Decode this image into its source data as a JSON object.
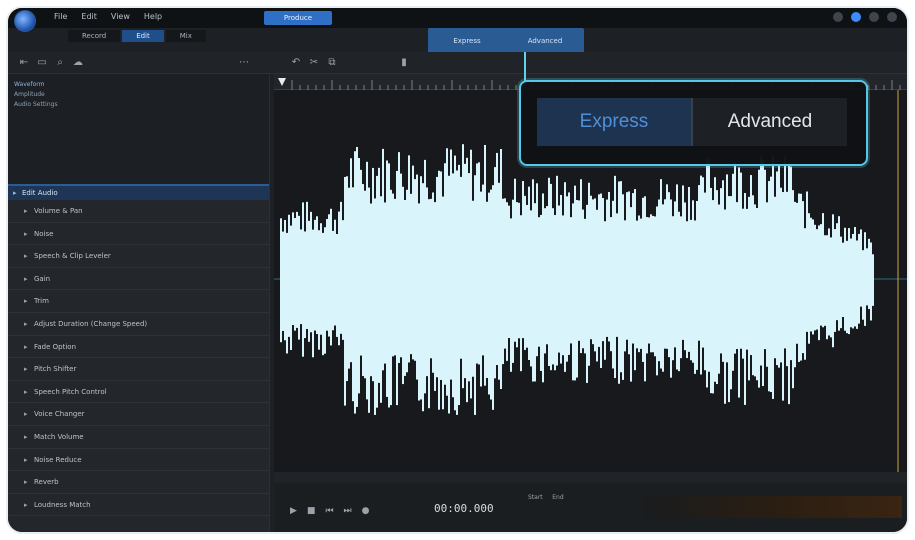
{
  "titlebar": {
    "menu": [
      "File",
      "Edit",
      "View",
      "Help"
    ],
    "tabs": [
      "Record",
      "Edit",
      "Mix"
    ],
    "produce_label": "Produce"
  },
  "mode_toggle": {
    "express": "Express",
    "advanced": "Advanced"
  },
  "left_panel": {
    "status_items": [
      "Waveform",
      "Amplitude",
      "Audio Settings"
    ],
    "section": "Edit Audio",
    "effects": [
      "Volume & Pan",
      "Noise",
      "Speech & Clip Leveler",
      "Gain",
      "Trim",
      "Adjust Duration (Change Speed)",
      "Fade Option",
      "Pitch Shifter",
      "Speech Pitch Control",
      "Voice Changer",
      "Match Volume",
      "Noise Reduce",
      "Reverb",
      "Loudness Match"
    ]
  },
  "transport": {
    "time": "00:00.000",
    "start_label": "Start",
    "end_label": "End"
  },
  "colors": {
    "accent": "#2f6fc5",
    "callout": "#55c8e6",
    "express_text": "#4f8fd6",
    "waveform": "#d9f4fb"
  }
}
